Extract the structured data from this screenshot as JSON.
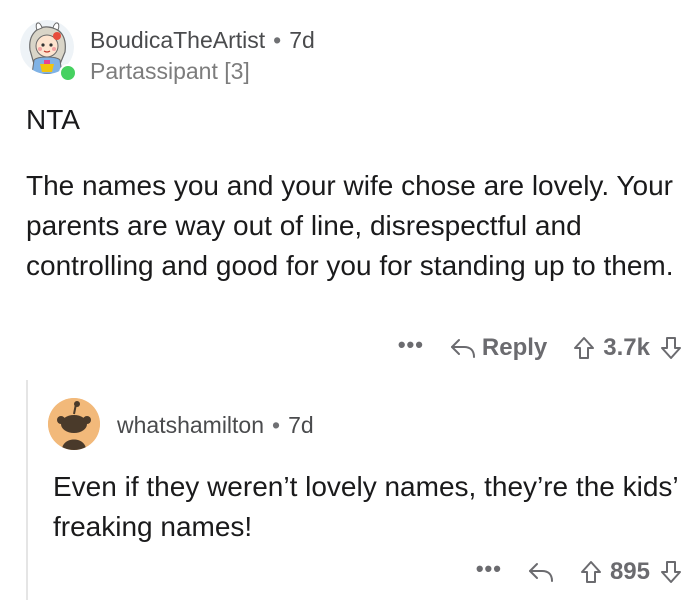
{
  "comment": {
    "username": "BoudicaTheArtist",
    "separator": "•",
    "age": "7d",
    "flair": "Partassipant [3]",
    "verdict": "NTA",
    "body": "The names you and your wife chose are lovely. Your parents are way out of line, disrespectful and controlling and good for you for standing up to them.",
    "more_label": "•••",
    "reply_label": "Reply",
    "score": "3.7k",
    "avatar_icon": "cartoon-artist-avatar-icon",
    "online_color": "#46d160"
  },
  "reply": {
    "username": "whatshamilton",
    "separator": "•",
    "age": "7d",
    "body": "Even if they weren’t lovely names, they’re the kids’ freaking names!",
    "more_label": "•••",
    "score": "895",
    "avatar_icon": "snoo-default-avatar-icon",
    "avatar_color": "#f2b97a"
  },
  "icons": {
    "reply": "reply-arrow-icon",
    "upvote": "upvote-arrow-icon",
    "downvote": "downvote-arrow-icon"
  }
}
